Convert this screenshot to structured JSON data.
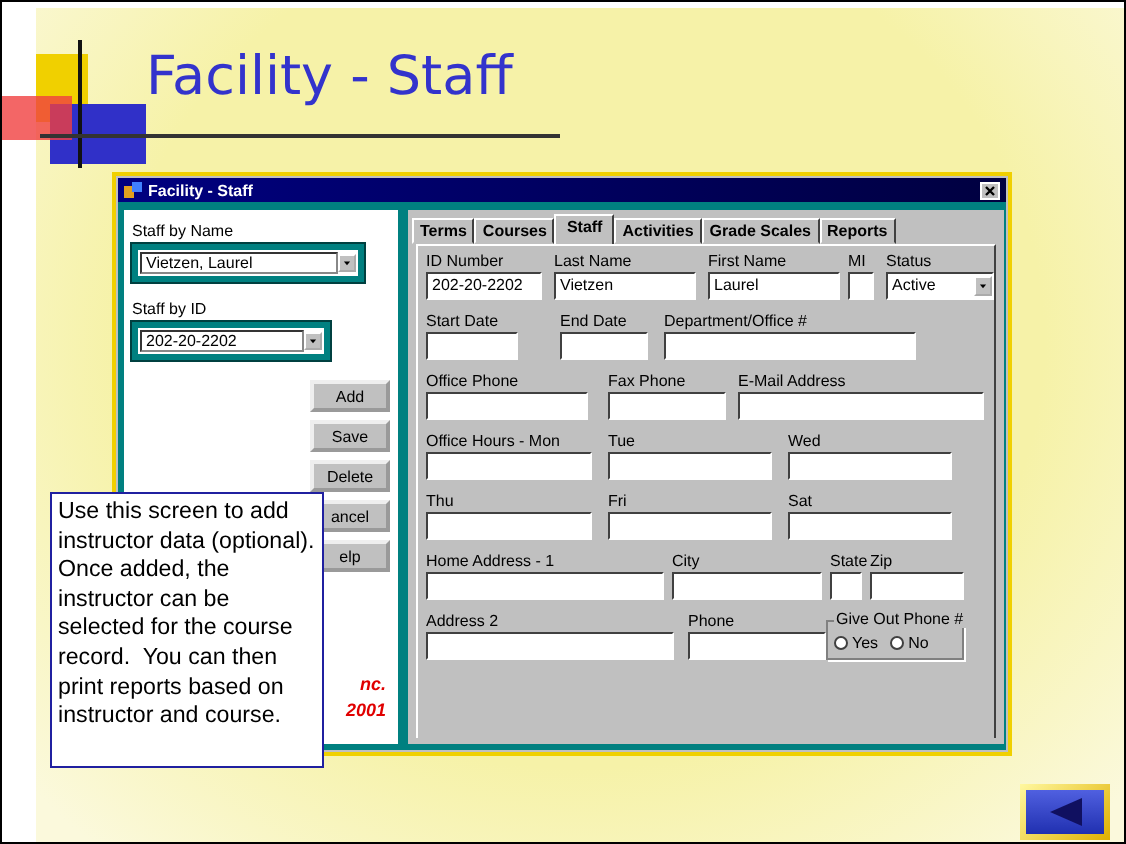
{
  "slide": {
    "title": "Facility - Staff",
    "callout": "Use this screen to add instructor data (optional).  Once added, the instructor can be selected for the course record.  You can then print reports based on instructor and course.",
    "nav_button": {
      "kind": "back"
    }
  },
  "window": {
    "title": "Facility - Staff",
    "staff_by_name": {
      "label": "Staff by Name",
      "value": "Vietzen, Laurel"
    },
    "staff_by_id": {
      "label": "Staff by ID",
      "value": "202-20-2202"
    },
    "buttons": [
      "Add",
      "Save",
      "Delete",
      "ancel",
      "elp"
    ],
    "footer_text": [
      "nc.",
      "2001"
    ],
    "tabs": [
      {
        "label": "Terms",
        "selected": false
      },
      {
        "label": "Courses",
        "selected": false
      },
      {
        "label": "Staff",
        "selected": true
      },
      {
        "label": "Activities",
        "selected": false
      },
      {
        "label": "Grade Scales",
        "selected": false
      },
      {
        "label": "Reports",
        "selected": false
      }
    ],
    "form_rows": [
      [
        {
          "label": "ID Number",
          "value": "202-20-2202",
          "kind": "text"
        },
        {
          "label": "Last Name",
          "value": "Vietzen",
          "kind": "text"
        },
        {
          "label": "First Name",
          "value": "Laurel",
          "kind": "text"
        },
        {
          "label": "MI",
          "kind": "text"
        },
        {
          "label": "Status",
          "value": "Active",
          "kind": "combo"
        }
      ],
      [
        {
          "label": "Start Date",
          "kind": "text"
        },
        {
          "label": "End Date",
          "kind": "text"
        },
        {
          "label": "Department/Office #",
          "kind": "text"
        }
      ],
      [
        {
          "label": "Office Phone",
          "kind": "text"
        },
        {
          "label": "Fax Phone",
          "kind": "text"
        },
        {
          "label": "E-Mail Address",
          "kind": "text"
        }
      ],
      [
        {
          "label": "Office Hours - Mon",
          "kind": "text"
        },
        {
          "label": "Tue",
          "kind": "text"
        },
        {
          "label": "Wed",
          "kind": "text"
        }
      ],
      [
        {
          "label": "Thu",
          "kind": "text"
        },
        {
          "label": "Fri",
          "kind": "text"
        },
        {
          "label": "Sat",
          "kind": "text"
        }
      ],
      [
        {
          "label": "Home Address  - 1",
          "kind": "text"
        },
        {
          "label": "City",
          "kind": "text"
        },
        {
          "label": "State",
          "kind": "text"
        },
        {
          "label": "Zip",
          "kind": "text"
        }
      ],
      [
        {
          "label": "Address 2",
          "kind": "text"
        },
        {
          "label": "Phone",
          "kind": "text"
        },
        {
          "label": "Give Out Phone #",
          "kind": "radio",
          "options": [
            {
              "label": "Yes",
              "selected": false
            },
            {
              "label": "No",
              "selected": false
            }
          ]
        }
      ]
    ]
  }
}
